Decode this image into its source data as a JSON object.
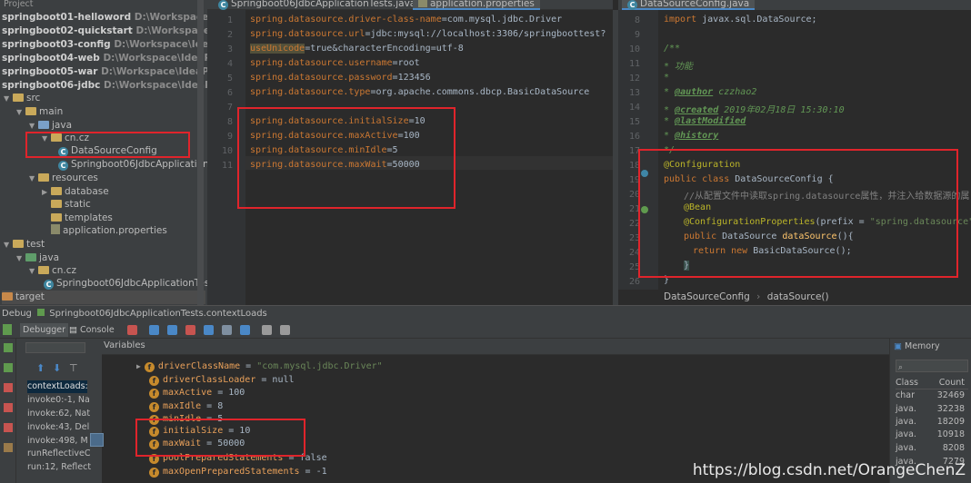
{
  "project": {
    "title": "Project",
    "modules": [
      {
        "name": "springboot01-helloword",
        "path": "D:\\Workspace\\IdeaProje"
      },
      {
        "name": "springboot02-quickstart",
        "path": "D:\\Workspace\\IdeaProj"
      },
      {
        "name": "springboot03-config",
        "path": "D:\\Workspace\\IdeaProjects\\"
      },
      {
        "name": "springboot04-web",
        "path": "D:\\Workspace\\IdeaProjects\\Sp"
      },
      {
        "name": "springboot05-war",
        "path": "D:\\Workspace\\IdeaProjects\\Sp"
      },
      {
        "name": "springboot06-jdbc",
        "path": "D:\\Workspace\\IdeaProjects\\Sp"
      }
    ],
    "tree": {
      "src": "src",
      "main": "main",
      "java": "java",
      "pkg": "cn.cz",
      "cls1": "DataSourceConfig",
      "cls2": "Springboot06JdbcApplication",
      "resources": "resources",
      "database": "database",
      "static": "static",
      "templates": "templates",
      "appprops": "application.properties",
      "test": "test",
      "tjava": "java",
      "tpkg": "cn.cz",
      "tcls": "Springboot06JdbcApplicationTes",
      "target": "target"
    }
  },
  "editor1": {
    "tab": "Springboot06JdbcApplicationTests.java",
    "tab_active": "application.properties",
    "line_numbers": [
      "1",
      "2",
      "3",
      "4",
      "5",
      "6",
      "7",
      "8",
      "9",
      "10",
      "11"
    ],
    "lines": [
      {
        "key": "spring.datasource.driver-class-name",
        "val": "com.mysql.jdbc.Driver"
      },
      {
        "key": "spring.datasource.url",
        "val": "jdbc:mysql://localhost:3306/springboottest?"
      },
      {
        "key": "useUnicode",
        "val": "true&characterEncoding=utf-8"
      },
      {
        "key": "spring.datasource.username",
        "val": "root"
      },
      {
        "key": "spring.datasource.password",
        "val": "123456"
      },
      {
        "key": "spring.datasource.type",
        "val": "org.apache.commons.dbcp.BasicDataSource"
      },
      {
        "key": "",
        "val": ""
      },
      {
        "key": "spring.datasource.initialSize",
        "val": "10"
      },
      {
        "key": "spring.datasource.maxActive",
        "val": "100"
      },
      {
        "key": "spring.datasource.minIdle",
        "val": "5"
      },
      {
        "key": "spring.datasource.maxWait",
        "val": "50000"
      }
    ]
  },
  "editor2": {
    "tab": "DataSourceConfig.java",
    "line_numbers": [
      "8",
      "9",
      "10",
      "11",
      "12",
      "13",
      "14",
      "15",
      "16",
      "17",
      "18",
      "19",
      "20",
      "21",
      "22",
      "23",
      "24",
      "25",
      "26"
    ],
    "import_kw": "import",
    "import_rest": " javax.sql.DataSource;",
    "doc_open": "/**",
    "doc_func": " * 功能",
    "doc_star": " *",
    "author_tag": "@author",
    "author_val": " czzhao2",
    "created_tag": "@created",
    "created_val": " 2019年02月18日 15:30:10",
    "lastmod_tag": "@lastModified",
    "history_tag": "@history",
    "doc_close": " */",
    "configuration": "@Configuration",
    "class_decl_kw": "public class",
    "class_name": " DataSourceConfig {",
    "comment_line": "//从配置文件中读取spring.datasource属性，并注入给数据源的属",
    "bean": "@Bean",
    "cfg_props": "@ConfigurationProperties",
    "cfg_prefix": "(prefix = ",
    "cfg_prefix_val": "\"spring.datasource\"",
    "cfg_close": ")",
    "method_kw": "public",
    "method_type": " DataSource ",
    "method_name": "dataSource",
    "method_rest": "(){",
    "return_kw": "return new",
    "return_rest": " BasicDataSource();",
    "brace": "}",
    "brace2": "}"
  },
  "breadcrumbs": [
    "DataSourceConfig",
    "dataSource()"
  ],
  "debug": {
    "header": "Debug",
    "config": "Springboot06JdbcApplicationTests.contextLoads",
    "tab_debugger": "Debugger",
    "tab_console": "Console",
    "variables_label": "Variables",
    "memory_label": "Memory",
    "frames": [
      "contextLoads:",
      "invoke0:-1, Na",
      "invoke:62, Nat",
      "invoke:43, Del",
      "invoke:498, M",
      "runReflectiveC",
      "run:12, Reflect"
    ],
    "variables": [
      {
        "name": "driverClassName",
        "eq": " = ",
        "value": "\"com.mysql.jdbc.Driver\"",
        "is_string": true
      },
      {
        "name": "driverClassLoader",
        "eq": " = ",
        "value": "null",
        "is_string": false
      },
      {
        "name": "maxActive",
        "eq": " = ",
        "value": "100",
        "is_string": false
      },
      {
        "name": "maxIdle",
        "eq": " = ",
        "value": "8",
        "is_string": false
      },
      {
        "name": "minIdle",
        "eq": " = ",
        "value": "5",
        "is_string": false
      },
      {
        "name": "initialSize",
        "eq": " = ",
        "value": "10",
        "is_string": false
      },
      {
        "name": "maxWait",
        "eq": " = ",
        "value": "50000",
        "is_string": false
      },
      {
        "name": "poolPreparedStatements",
        "eq": " = ",
        "value": "false",
        "is_string": false
      },
      {
        "name": "maxOpenPreparedStatements",
        "eq": " = ",
        "value": "-1",
        "is_string": false
      }
    ],
    "memory": {
      "col_class": "Class",
      "col_count": "Count",
      "rows": [
        {
          "cls": "char",
          "count": "32469"
        },
        {
          "cls": "java.",
          "count": "32238"
        },
        {
          "cls": "java.",
          "count": "18209"
        },
        {
          "cls": "java.",
          "count": "10918"
        },
        {
          "cls": "java.",
          "count": "8208"
        },
        {
          "cls": "java.",
          "count": "7279"
        }
      ]
    }
  },
  "watermark": "https://blog.csdn.net/OrangeChenZ",
  "colors": {
    "highlight_box": "#e0242b",
    "accent": "#4a88c7"
  }
}
